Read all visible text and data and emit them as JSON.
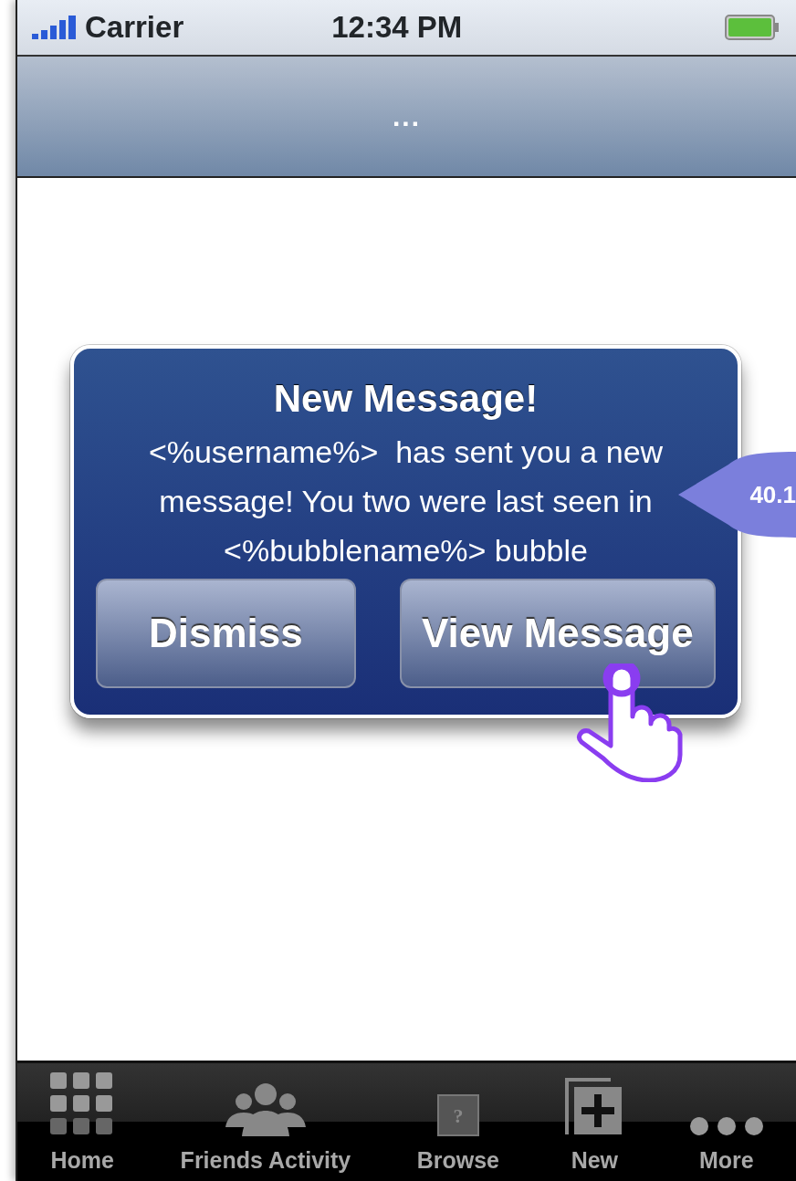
{
  "status_bar": {
    "carrier": "Carrier",
    "time": "12:34 PM"
  },
  "nav_bar": {
    "title": "..."
  },
  "alert": {
    "title": "New Message!",
    "message": "<%username%>  has sent you a new message! You two were last seen in <%bubblename%> bubble",
    "buttons": [
      {
        "label": "Dismiss",
        "kind": "plain"
      },
      {
        "label": "View Message",
        "kind": "tapped"
      }
    ]
  },
  "callout": {
    "label": "40.1"
  },
  "tab_bar": [
    {
      "label": "Home",
      "kind": "grid"
    },
    {
      "label": "Friends Activity",
      "kind": "people"
    },
    {
      "label": "Browse",
      "kind": "question",
      "glyph": "?"
    },
    {
      "label": "New",
      "kind": "plus"
    },
    {
      "label": "More",
      "kind": "dots"
    }
  ]
}
